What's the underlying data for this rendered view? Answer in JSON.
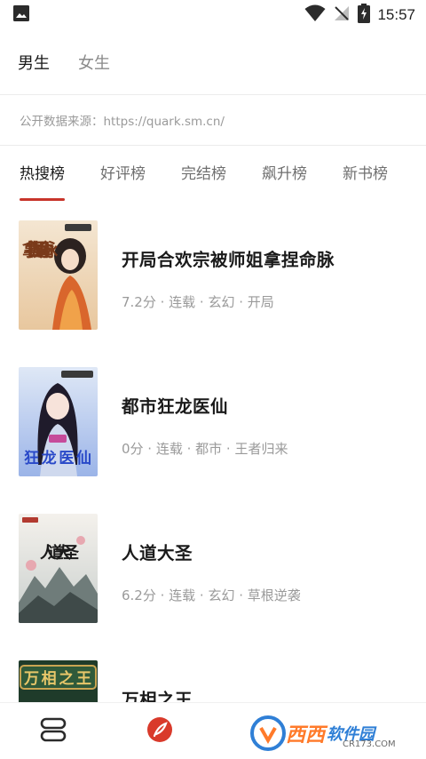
{
  "status_bar": {
    "time": "15:57"
  },
  "gender_tabs": [
    {
      "label": "男生",
      "active": true
    },
    {
      "label": "女生",
      "active": false
    }
  ],
  "source": "公开数据来源：https://quark.sm.cn/",
  "rank_tabs": [
    {
      "label": "热搜榜",
      "active": true
    },
    {
      "label": "好评榜",
      "active": false
    },
    {
      "label": "完结榜",
      "active": false
    },
    {
      "label": "飙升榜",
      "active": false
    },
    {
      "label": "新书榜",
      "active": false
    }
  ],
  "books": [
    {
      "title": "开局合欢宗被师姐拿捏命脉",
      "meta": "7.2分 · 连载 · 玄幻 · 开局",
      "cover_text": "拿捏师姐命脉"
    },
    {
      "title": "都市狂龙医仙",
      "meta": "0分 · 连载 · 都市 · 王者归来",
      "cover_text": "狂龙医仙"
    },
    {
      "title": "人道大圣",
      "meta": "6.2分 · 连载 · 玄幻 · 草根逆袭",
      "cover_text": "人道大圣"
    },
    {
      "title": "万相之王",
      "meta": "",
      "cover_text": "万相之王"
    }
  ],
  "watermark": {
    "text1": "西西",
    "text2": "软件园",
    "sub": "CR173.COM"
  },
  "colors": {
    "accent": "#c8342a",
    "text": "#1a1a1a",
    "muted": "#9a9a9a"
  },
  "icons": {
    "status_left": "image-icon",
    "wifi": "wifi-icon",
    "signal": "signal-off-icon",
    "battery": "battery-charging-icon",
    "nav_left": "bookshelf-icon",
    "nav_center": "discover-feather-icon"
  }
}
